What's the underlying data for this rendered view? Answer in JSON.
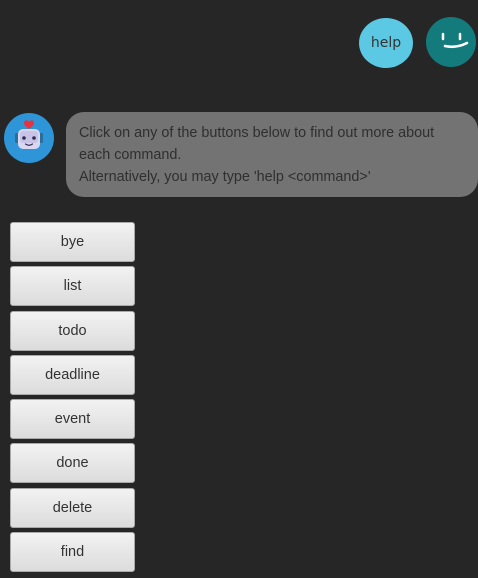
{
  "user_message": {
    "text": "help",
    "avatar_icon": "smiley-face-icon",
    "bubble_color": "#5bc8e4",
    "avatar_color": "#137b7c"
  },
  "bot_message": {
    "avatar_icon": "robot-icon",
    "avatar_color": "#2d95d8",
    "bubble_color": "#737373",
    "lines": [
      "Click on any of the buttons below to find out more about",
      "each command.",
      "Alternatively, you may type 'help <command>'"
    ]
  },
  "commands": [
    {
      "label": "bye"
    },
    {
      "label": "list"
    },
    {
      "label": "todo"
    },
    {
      "label": "deadline"
    },
    {
      "label": "event"
    },
    {
      "label": "done"
    },
    {
      "label": "delete"
    },
    {
      "label": "find"
    }
  ]
}
